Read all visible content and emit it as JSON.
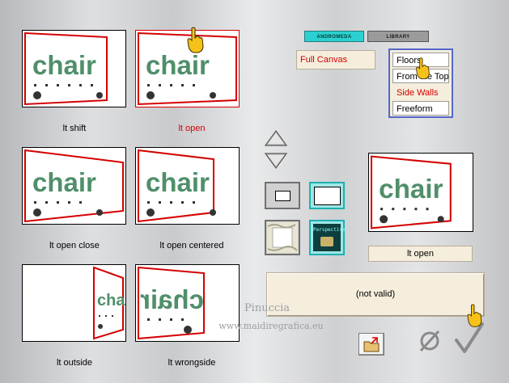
{
  "thumbnails": [
    {
      "caption": "lt shift",
      "text": "chair",
      "selected": false
    },
    {
      "caption": "lt open",
      "text": "chair",
      "selected": true
    },
    {
      "caption": "lt open close",
      "text": "chair",
      "selected": false
    },
    {
      "caption": "lt open centered",
      "text": "chair",
      "selected": false
    },
    {
      "caption": "lt outside",
      "text": "chair",
      "selected": false
    },
    {
      "caption": "lt wrongside",
      "text": "chair",
      "selected": false
    }
  ],
  "tabs": {
    "andromeda": "ANDROMEDA",
    "library": "LIBRARY"
  },
  "category_field": "Full Canvas",
  "subcategories": [
    "Floors",
    "From the Top",
    "Side Walls",
    "Freeform"
  ],
  "selected_subcategory": "Side Walls",
  "preview": {
    "text": "chair",
    "name": "lt open"
  },
  "perspective_button": "Perspective",
  "status": "(not valid)",
  "watermark": {
    "line1": "Pinuccia",
    "line2": "www.maidiregrafica.eu"
  },
  "colors": {
    "selected_red": "#d40000",
    "chair_green": "#4f8f6a",
    "accent_cyan": "#2dd0d0",
    "list_border": "#5567c9"
  },
  "icons": {
    "ok": "checkmark-icon",
    "cancel": "cancel-icon",
    "folder": "open-folder-icon",
    "cursor": "hand-pointer-icon"
  }
}
